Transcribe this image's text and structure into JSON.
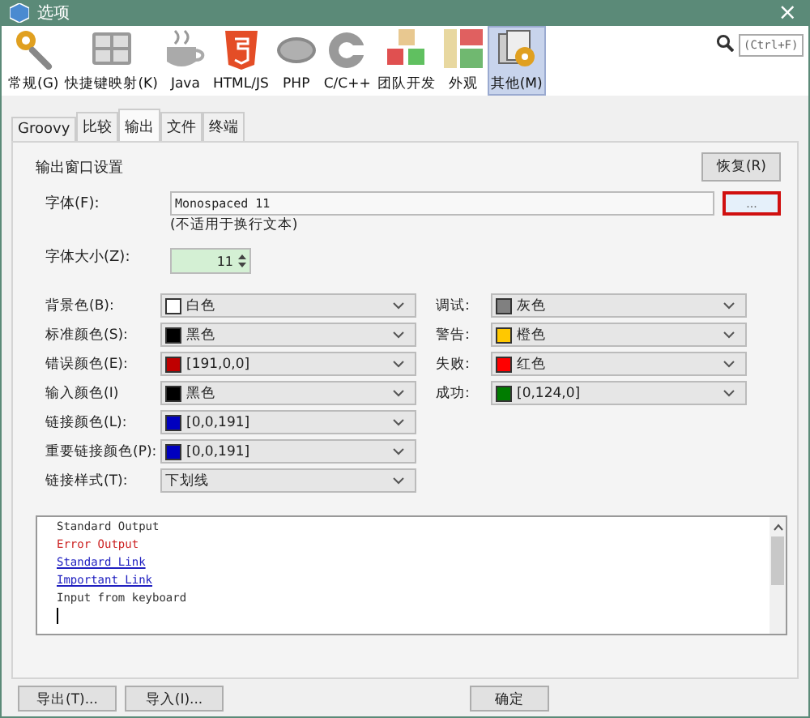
{
  "window": {
    "title": "选项",
    "close": "×"
  },
  "categories": [
    {
      "label": "常规(G)",
      "selected": false
    },
    {
      "label": "快捷键映射(K)",
      "selected": false
    },
    {
      "label": "Java",
      "selected": false
    },
    {
      "label": "HTML/JS",
      "selected": false
    },
    {
      "label": "PHP",
      "selected": false
    },
    {
      "label": "C/C++",
      "selected": false
    },
    {
      "label": "团队开发",
      "selected": false
    },
    {
      "label": "外观",
      "selected": false
    },
    {
      "label": "其他(M)",
      "selected": true
    }
  ],
  "search": {
    "placeholder": "(Ctrl+F)"
  },
  "tabs": [
    {
      "label": "Groovy",
      "selected": false
    },
    {
      "label": "比较",
      "selected": false
    },
    {
      "label": "输出",
      "selected": true
    },
    {
      "label": "文件",
      "selected": false
    },
    {
      "label": "终端",
      "selected": false
    }
  ],
  "section_title": "输出窗口设置",
  "restore_button": "恢复(R)",
  "font": {
    "label": "字体(F):",
    "value": "Monospaced 11",
    "browse": "...",
    "note": "(不适用于换行文本)"
  },
  "font_size": {
    "label": "字体大小(Z):",
    "value": "11"
  },
  "left_colors": [
    {
      "kind": "color",
      "label": "背景色(B):",
      "value": "白色",
      "color": "#ffffff"
    },
    {
      "kind": "color",
      "label": "标准颜色(S):",
      "value": "黑色",
      "color": "#000000"
    },
    {
      "kind": "color",
      "label": "错误颜色(E):",
      "value": "[191,0,0]",
      "color": "#bf0000"
    },
    {
      "kind": "color",
      "label": "输入颜色(I)",
      "value": "黑色",
      "color": "#000000"
    },
    {
      "kind": "color",
      "label": "链接颜色(L):",
      "value": "[0,0,191]",
      "color": "#0000bf"
    },
    {
      "kind": "color",
      "label": "重要链接颜色(P):",
      "value": "[0,0,191]",
      "color": "#0000bf"
    },
    {
      "kind": "plain",
      "label": "链接样式(T):",
      "value": "下划线"
    }
  ],
  "right_colors": [
    {
      "kind": "color",
      "label": "调试:",
      "value": "灰色",
      "color": "#808080"
    },
    {
      "kind": "color",
      "label": "警告:",
      "value": "橙色",
      "color": "#ffc800"
    },
    {
      "kind": "color",
      "label": "失败:",
      "value": "红色",
      "color": "#ff0000"
    },
    {
      "kind": "color",
      "label": "成功:",
      "value": "[0,124,0]",
      "color": "#007c00"
    }
  ],
  "preview": [
    {
      "kind": "standard",
      "text": "Standard Output"
    },
    {
      "kind": "error",
      "text": "Error Output"
    },
    {
      "kind": "link",
      "text": "Standard Link"
    },
    {
      "kind": "link",
      "text": "Important Link"
    },
    {
      "kind": "input",
      "text": "Input from keyboard"
    }
  ],
  "footer": {
    "export": "导出(T)...",
    "import": "导入(I)...",
    "ok": "确定"
  }
}
